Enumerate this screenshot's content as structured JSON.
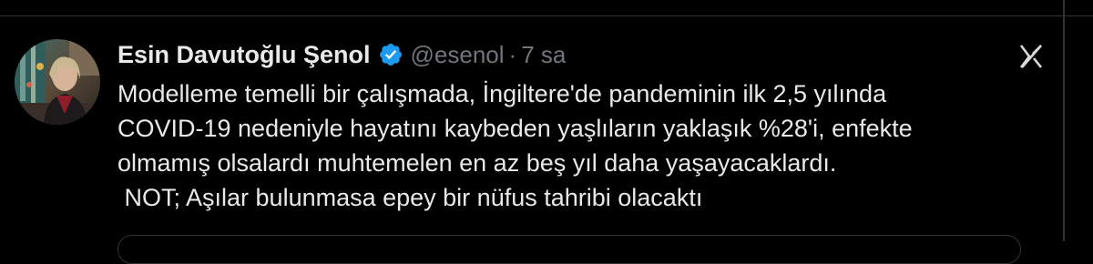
{
  "author": {
    "name": "Esin Davutoğlu Şenol",
    "handle": "@esenol",
    "separator": "·",
    "time": "7 sa",
    "verified_color": "#1d9bf0"
  },
  "tweet": {
    "lines": [
      "Modelleme temelli bir çalışmada, İngiltere'de pandeminin ilk 2,5 yılında",
      "COVID-19 nedeniyle hayatını kaybeden yaşlıların yaklaşık %28'i, enfekte",
      "olmamış olsalardı muhtemelen en az beş yıl daha yaşayacaklardı.",
      " NOT; Aşılar bulunmasa epey bir nüfus tahribi olacaktı"
    ]
  },
  "icons": {
    "verified": "verified-badge-icon",
    "grok": "grok-icon",
    "avatar": "avatar-photo"
  },
  "colors": {
    "background": "#000000",
    "text_primary": "#e7e9ea",
    "text_secondary": "#71767b",
    "border": "#2f3336",
    "accent": "#1d9bf0"
  }
}
